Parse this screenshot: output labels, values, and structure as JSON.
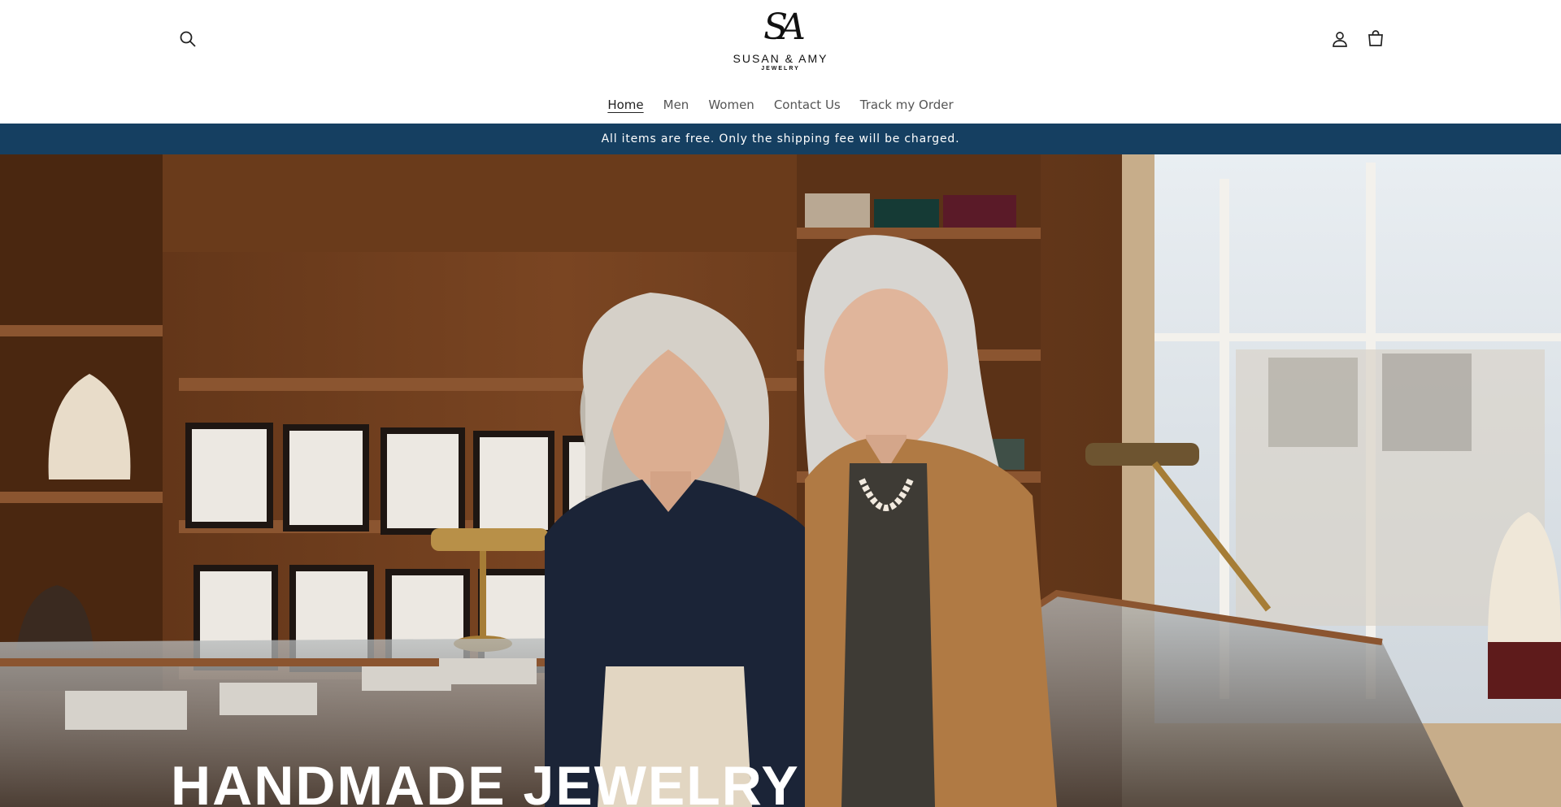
{
  "header": {
    "logo": {
      "monogram": "SA",
      "brand": "SUSAN & AMY",
      "sub": "JEWELRY"
    },
    "icons": {
      "search": "search-icon",
      "account": "account-icon",
      "cart": "cart-icon"
    }
  },
  "nav": {
    "items": [
      {
        "label": "Home",
        "active": true
      },
      {
        "label": "Men",
        "active": false
      },
      {
        "label": "Women",
        "active": false
      },
      {
        "label": "Contact Us",
        "active": false
      },
      {
        "label": "Track my Order",
        "active": false
      }
    ]
  },
  "announcement": {
    "text": "All items are free. Only the shipping fee will be charged.",
    "background": "#153f61"
  },
  "hero": {
    "title": "HANDMADE JEWELRY"
  }
}
